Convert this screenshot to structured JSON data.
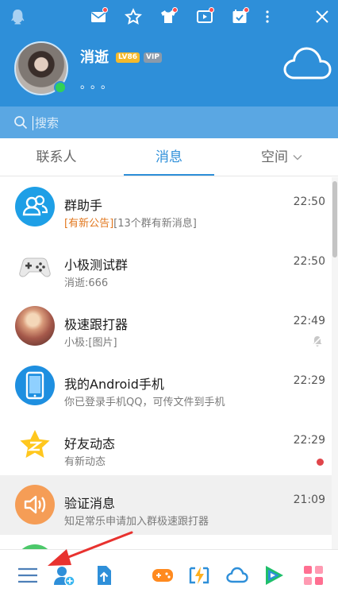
{
  "window": {
    "icons": [
      "penguin-icon",
      "mail-icon",
      "star-icon",
      "shirt-icon",
      "video-icon",
      "calendar-icon",
      "more-icon",
      "close-icon"
    ]
  },
  "profile": {
    "nickname": "消逝",
    "level_badge": "LV86",
    "vip_badge": "VIP",
    "signature": "。。。",
    "status": "online",
    "weather_icon": "cloud-icon"
  },
  "search": {
    "placeholder": "搜索"
  },
  "tabs": [
    {
      "label": "联系人",
      "active": false
    },
    {
      "label": "消息",
      "active": true
    },
    {
      "label": "空间",
      "active": false
    }
  ],
  "messages": [
    {
      "title": "群助手",
      "sub_highlight": "[有新公告]",
      "sub": "[13个群有新消息]",
      "time": "22:50",
      "icon": "group-assistant-icon"
    },
    {
      "title": "小极测试群",
      "sub": "消逝:666",
      "time": "22:50",
      "icon": "gamepad-avatar"
    },
    {
      "title": "极速跟打器",
      "sub": "小极:[图片]",
      "time": "22:49",
      "icon": "photo-avatar",
      "muted": true
    },
    {
      "title": "我的Android手机",
      "sub": "你已登录手机QQ，可传文件到手机",
      "time": "22:29",
      "icon": "phone-icon"
    },
    {
      "title": "好友动态",
      "sub": "有新动态",
      "time": "22:29",
      "icon": "qzone-star-icon",
      "unread": true
    },
    {
      "title": "验证消息",
      "sub": "知足常乐申请加入群极速跟打器",
      "time": "21:09",
      "icon": "speaker-icon",
      "selected": true
    }
  ],
  "bottombar": {
    "icons": [
      "menu-icon",
      "add-friend-icon",
      "upload-icon",
      "game-icon",
      "flash-icon",
      "weiyun-cloud-icon",
      "tencent-video-icon",
      "apps-grid-icon"
    ]
  },
  "colors": {
    "header": "#2e8fd9",
    "search_bar": "#5aa7e3",
    "accent": "#2e8fd9",
    "highlight": "#e2781f",
    "online": "#31d158",
    "annotation_arrow": "#e8322f"
  }
}
